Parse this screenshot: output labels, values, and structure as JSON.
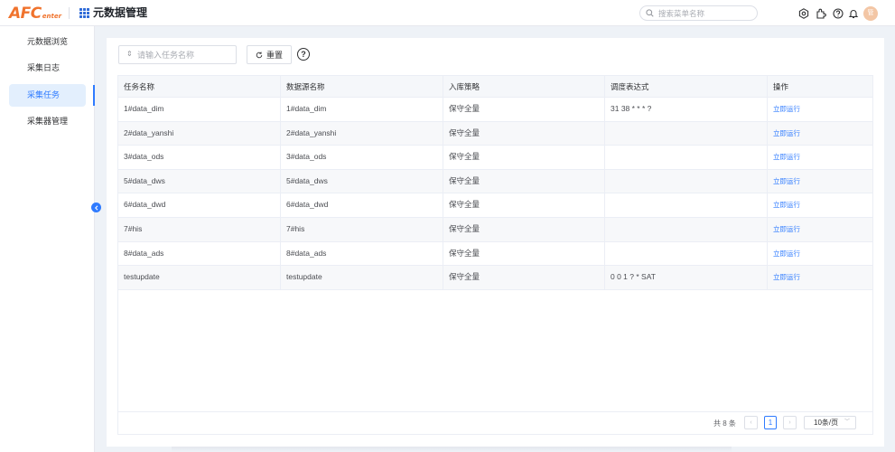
{
  "header": {
    "logo_main": "AFC",
    "logo_sub": "enter",
    "app_title": "元数据管理",
    "search_placeholder": "搜索菜单名称",
    "avatar_text": "管"
  },
  "sidebar": {
    "items": [
      {
        "label": "元数据浏览",
        "active": false
      },
      {
        "label": "采集日志",
        "active": false
      },
      {
        "label": "采集任务",
        "active": true
      },
      {
        "label": "采集器管理",
        "active": false
      }
    ],
    "accent_color": "#2f7bff"
  },
  "toolbar": {
    "task_placeholder": "请输入任务名称",
    "reset_label": "重置",
    "help_label": "?"
  },
  "table": {
    "columns": [
      "任务名称",
      "数据源名称",
      "入库策略",
      "调度表达式",
      "操作"
    ],
    "rows": [
      {
        "task": "1#data_dim",
        "source": "1#data_dim",
        "strategy": "保守全量",
        "cron": "31 38 * * * ?",
        "action": "立即运行"
      },
      {
        "task": "2#data_yanshi",
        "source": "2#data_yanshi",
        "strategy": "保守全量",
        "cron": "",
        "action": "立即运行"
      },
      {
        "task": "3#data_ods",
        "source": "3#data_ods",
        "strategy": "保守全量",
        "cron": "",
        "action": "立即运行"
      },
      {
        "task": "5#data_dws",
        "source": "5#data_dws",
        "strategy": "保守全量",
        "cron": "",
        "action": "立即运行"
      },
      {
        "task": "6#data_dwd",
        "source": "6#data_dwd",
        "strategy": "保守全量",
        "cron": "",
        "action": "立即运行"
      },
      {
        "task": "7#his",
        "source": "7#his",
        "strategy": "保守全量",
        "cron": "",
        "action": "立即运行"
      },
      {
        "task": "8#data_ads",
        "source": "8#data_ads",
        "strategy": "保守全量",
        "cron": "",
        "action": "立即运行"
      },
      {
        "task": "testupdate",
        "source": "testupdate",
        "strategy": "保守全量",
        "cron": "0 0 1 ? * SAT",
        "action": "立即运行"
      }
    ]
  },
  "pagination": {
    "total_text": "共 8 条",
    "prev": "‹",
    "current_page": "1",
    "next": "›",
    "page_size": "10条/页"
  }
}
